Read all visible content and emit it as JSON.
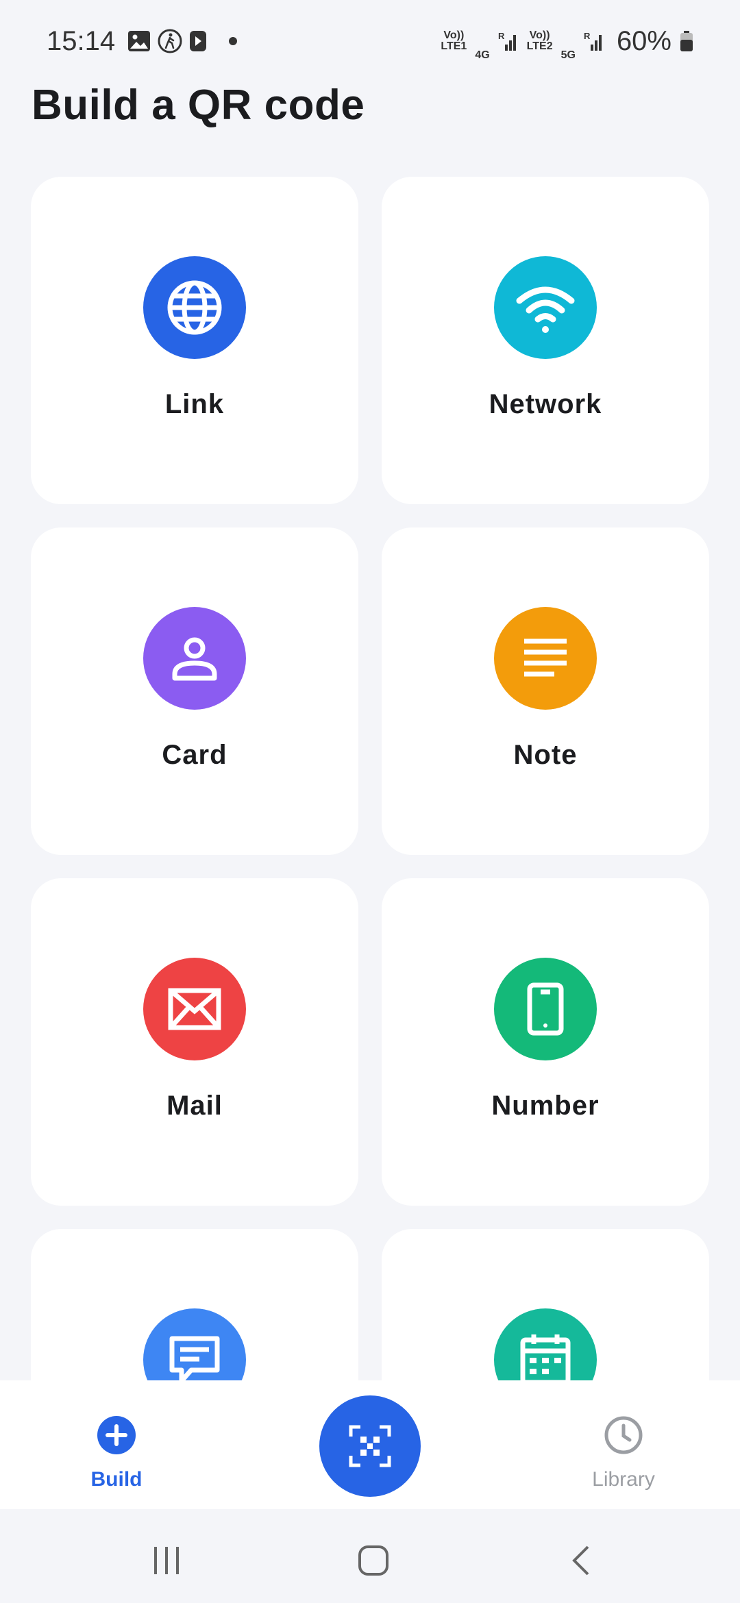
{
  "status_bar": {
    "time": "15:14",
    "net1_top": "Vo))",
    "net1_bottom": "LTE1",
    "net1_type": "4G",
    "net2_top": "Vo))",
    "net2_bottom": "LTE2",
    "net2_type": "5G",
    "roaming": "R",
    "battery": "60%"
  },
  "page": {
    "title": "Build a QR code"
  },
  "tiles": [
    {
      "label": "Link",
      "icon": "globe-icon",
      "color": "#2764e5"
    },
    {
      "label": "Network",
      "icon": "wifi-icon",
      "color": "#0fb8d6"
    },
    {
      "label": "Card",
      "icon": "person-icon",
      "color": "#8b5cf1"
    },
    {
      "label": "Note",
      "icon": "note-lines-icon",
      "color": "#f39c0b"
    },
    {
      "label": "Mail",
      "icon": "mail-icon",
      "color": "#ee4344"
    },
    {
      "label": "Number",
      "icon": "phone-icon",
      "color": "#14b979"
    },
    {
      "label": "",
      "icon": "message-icon",
      "color": "#3e86f3"
    },
    {
      "label": "",
      "icon": "calendar-icon",
      "color": "#15b99a"
    }
  ],
  "bottom_nav": {
    "build_label": "Build",
    "library_label": "Library",
    "active": "Build",
    "accent": "#2764e5"
  }
}
